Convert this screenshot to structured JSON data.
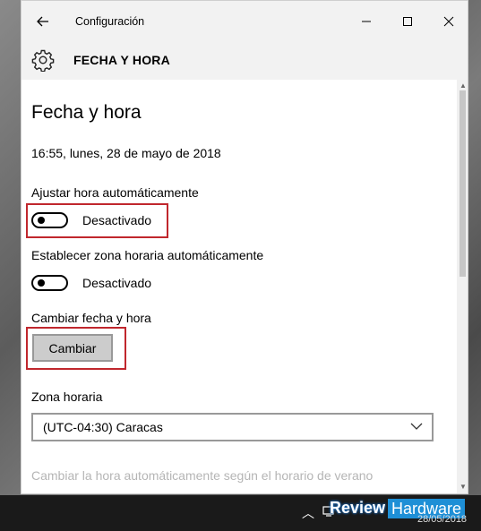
{
  "window": {
    "title": "Configuración",
    "section_title": "FECHA Y HORA"
  },
  "main": {
    "page_title": "Fecha y hora",
    "current_datetime": "16:55, lunes, 28 de mayo de 2018",
    "auto_time": {
      "label": "Ajustar hora automáticamente",
      "state": "Desactivado",
      "on": false
    },
    "auto_timezone": {
      "label": "Establecer zona horaria automáticamente",
      "state": "Desactivado",
      "on": false
    },
    "change_datetime": {
      "label": "Cambiar fecha y hora",
      "button": "Cambiar"
    },
    "timezone": {
      "label": "Zona horaria",
      "selected": "(UTC-04:30) Caracas"
    },
    "dst_label": "Cambiar la hora automáticamente según el horario de verano"
  },
  "taskbar": {
    "watermark_left": "Review",
    "watermark_right": "Hardware",
    "date": "28/05/2018"
  },
  "colors": {
    "highlight": "#c0272d",
    "watermark_blue": "#1e8fd6"
  },
  "icons": [
    "back-arrow-icon",
    "minimize-icon",
    "maximize-icon",
    "close-icon",
    "gear-icon",
    "chevron-down-icon",
    "chevron-up-icon",
    "network-icon"
  ]
}
